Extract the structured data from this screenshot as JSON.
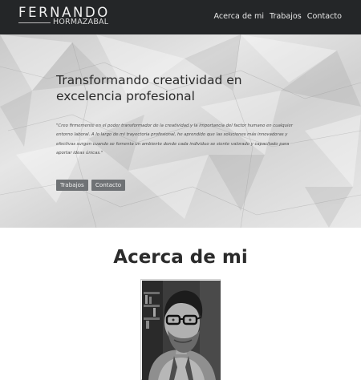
{
  "navbar": {
    "brand_first": "FERNANDO",
    "brand_last": "HORMAZABAL",
    "links": [
      "Acerca de mi",
      "Trabajos",
      "Contacto"
    ]
  },
  "hero": {
    "title": "Transformando creatividad en excelencia profesional",
    "quote": "\"Creo firmemente en el poder transformador de la creatividad y la importancia del factor humano en cualquier entorno laboral. A lo largo de mi trayectoria profesional, he aprendido que las soluciones más innovadoras y efectivas surgen cuando se fomenta un ambiente donde cada individuo se siente valorado y capacitado para aportar ideas únicas.\"",
    "buttons": [
      "Trabajos",
      "Contacto"
    ]
  },
  "about": {
    "heading": "Acerca de mi"
  },
  "colors": {
    "navbar_bg": "#242628",
    "button_bg": "#6f7275",
    "heading_text": "#2b2b2b"
  }
}
